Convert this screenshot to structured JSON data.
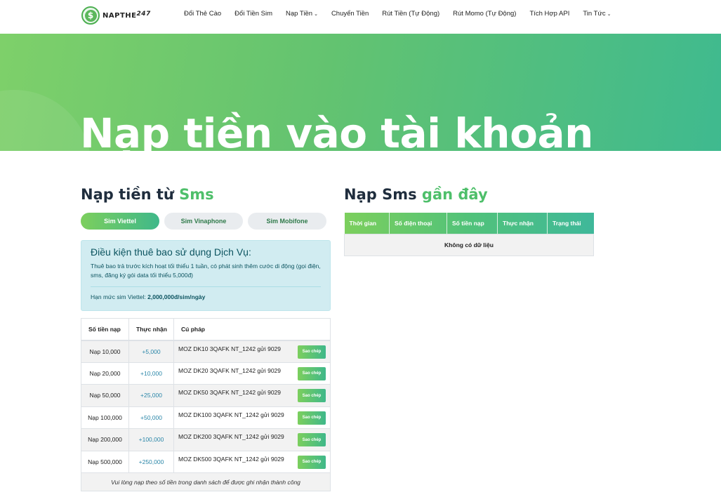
{
  "header": {
    "logo": {
      "text": "NAPTHE",
      "number": "247",
      "icon": "dollar-coin-icon"
    },
    "nav": [
      {
        "label": "Đổi Thẻ Cào",
        "has_caret": false
      },
      {
        "label": "Đổi Tiền Sim",
        "has_caret": false
      },
      {
        "label": "Nạp Tiền",
        "has_caret": true
      },
      {
        "label": "Chuyển Tiền",
        "has_caret": false
      },
      {
        "label": "Rút Tiền (Tự Động)",
        "has_caret": false
      },
      {
        "label": "Rút Momo (Tự Động)",
        "has_caret": false
      },
      {
        "label": "Tích Hợp API",
        "has_caret": false
      },
      {
        "label": "Tin Tức",
        "has_caret": true
      }
    ]
  },
  "hero": {
    "title": "Nạp tiền vào tài khoản"
  },
  "left": {
    "title_main": "Nạp tiền từ",
    "title_accent": "Sms",
    "tabs": [
      {
        "label": "Sim Viettel",
        "active": true
      },
      {
        "label": "Sim Vinaphone",
        "active": false
      },
      {
        "label": "Sim Mobifone",
        "active": false
      }
    ],
    "notice": {
      "title": "Điều kiện thuê bao sử dụng Dịch Vụ:",
      "text": "Thuê bao trả trước kích hoạt tối thiểu 1 tuần, có phát sinh thêm cước di động (gọi điện, sms, đăng ký gói data tối thiểu 5,000đ)",
      "limit_label": "Hạn mức sim Viettel:",
      "limit_value": "2,000,000đ/sim/ngày"
    },
    "table": {
      "headers": [
        "Số tiền nạp",
        "Thực nhận",
        "Cú pháp"
      ],
      "rows": [
        {
          "amount": "Nạp 10,000",
          "receive": "+5,000",
          "syntax": "MOZ DK10 3QAFK NT_1242 gửi 9029",
          "button": "Sao chép"
        },
        {
          "amount": "Nạp 20,000",
          "receive": "+10,000",
          "syntax": "MOZ DK20 3QAFK NT_1242 gửi 9029",
          "button": "Sao chép"
        },
        {
          "amount": "Nạp 50,000",
          "receive": "+25,000",
          "syntax": "MOZ DK50 3QAFK NT_1242 gửi 9029",
          "button": "Sao chép"
        },
        {
          "amount": "Nạp 100,000",
          "receive": "+50,000",
          "syntax": "MOZ DK100 3QAFK NT_1242 gửi 9029",
          "button": "Sao chép"
        },
        {
          "amount": "Nạp 200,000",
          "receive": "+100,000",
          "syntax": "MOZ DK200 3QAFK NT_1242 gửi 9029",
          "button": "Sao chép"
        },
        {
          "amount": "Nạp 500,000",
          "receive": "+250,000",
          "syntax": "MOZ DK500 3QAFK NT_1242 gửi 9029",
          "button": "Sao chép"
        }
      ],
      "footnote": "Vui lòng nạp theo số tiền trong danh sách để được ghi nhận thành công"
    }
  },
  "right": {
    "title_main": "Nạp Sms",
    "title_accent": "gần đây",
    "table": {
      "headers": [
        "Thời gian",
        "Số điện thoại",
        "Số tiền nạp",
        "Thực nhận",
        "Trạng thái"
      ],
      "empty": "Không có dữ liệu"
    }
  },
  "colors": {
    "brand_green": "#4ebf6a",
    "gradient_start": "#7ccf5d",
    "gradient_end": "#3fb88a",
    "info_bg": "#d1ecf1"
  }
}
